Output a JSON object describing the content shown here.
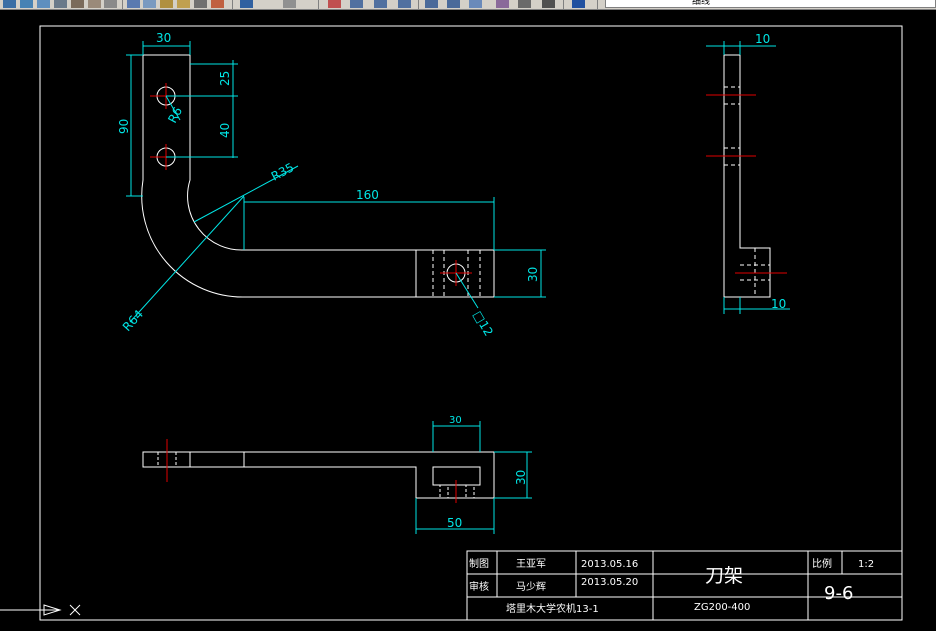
{
  "toolbar": {
    "layer_name": "细线",
    "icons": [
      "new-icon",
      "open-icon",
      "save-icon",
      "print-icon",
      "preview-icon",
      "cut-icon",
      "copy-icon",
      "paste-icon",
      "matchprop-icon",
      "undo-icon",
      "redo-icon",
      "pan-icon",
      "zoom-realtime-icon",
      "zoom-window-icon",
      "zoom-previous-icon",
      "properties-icon",
      "designcenter-icon",
      "toolpalette-icon",
      "sheetset-icon",
      "markup-icon",
      "calculator-icon",
      "help-icon",
      "layer-manager-icon",
      "layer-state-icon"
    ]
  },
  "drawing": {
    "dims": {
      "top_width": "30",
      "hole_spacing_1": "25",
      "hole_spacing_2": "40",
      "arm_height": "90",
      "hole_radius": "R6",
      "inner_radius": "R35",
      "outer_radius": "R64",
      "arm_length": "160",
      "end_height": "30",
      "square_hole": "□12",
      "side_thickness_top": "10",
      "side_thickness_bottom": "10",
      "plan_block_width": "30",
      "plan_height": "30",
      "plan_base_width": "50"
    }
  },
  "title_block": {
    "drawn_label": "制图",
    "drawn_by": "王亚军",
    "drawn_date": "2013.05.16",
    "checked_label": "审核",
    "checked_by": "马少辉",
    "checked_date": "2013.05.20",
    "part_name": "刀架",
    "scale_label": "比例",
    "scale_value": "1:2",
    "school": "塔里木大学农机13-1",
    "drawing_code": "ZG200-400",
    "sheet_number": "9-6"
  },
  "colors": {
    "background": "#000000",
    "object_lines": "#ffffff",
    "dimensions": "#00e5e5",
    "centerlines": "#e00000"
  }
}
